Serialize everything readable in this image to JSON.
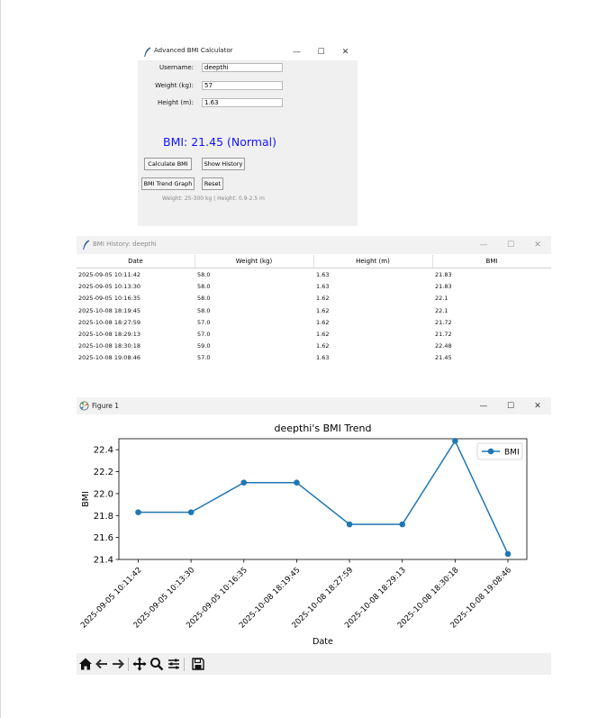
{
  "calculator": {
    "window_title": "Advanced BMI Calculator",
    "username_label": "Username:",
    "username_value": "deepthi",
    "weight_label": "Weight (kg):",
    "weight_value": "57",
    "height_label": "Height (m):",
    "height_value": "1.63",
    "result_text": "BMI: 21.45 (Normal)",
    "result_color": "#1414ff",
    "calculate_button": "Calculate BMI",
    "history_button": "Show History",
    "graph_button": "BMI Trend Graph",
    "reset_button": "Reset",
    "range_hint": "Weight: 25-300 kg | Height: 0.9-2.5 m",
    "minimize_icon": "—",
    "maximize_icon": "☐",
    "close_icon": "✕"
  },
  "history": {
    "window_title": "BMI History: deepthi",
    "columns": [
      "Date",
      "Weight (kg)",
      "Height (m)",
      "BMI"
    ],
    "rows": [
      [
        "2025-09-05 10:11:42",
        "58.0",
        "1.63",
        "21.83"
      ],
      [
        "2025-09-05 10:13:30",
        "58.0",
        "1.63",
        "21.83"
      ],
      [
        "2025-09-05 10:16:35",
        "58.0",
        "1.62",
        "22.1"
      ],
      [
        "2025-10-08 18:19:45",
        "58.0",
        "1.62",
        "22.1"
      ],
      [
        "2025-10-08 18:27:59",
        "57.0",
        "1.62",
        "21.72"
      ],
      [
        "2025-10-08 18:29:13",
        "57.0",
        "1.62",
        "21.72"
      ],
      [
        "2025-10-08 18:30:18",
        "59.0",
        "1.62",
        "22.48"
      ],
      [
        "2025-10-08 19:08:46",
        "57.0",
        "1.63",
        "21.45"
      ]
    ],
    "minimize_icon": "—",
    "maximize_icon": "☐",
    "close_icon": "✕"
  },
  "figure": {
    "window_title": "Figure 1",
    "minimize_icon": "—",
    "maximize_icon": "☐",
    "close_icon": "✕",
    "toolbar": [
      "home-icon",
      "back-arrow-icon",
      "forward-arrow-icon",
      "pan-icon",
      "zoom-icon",
      "configure-subplots-icon",
      "save-icon"
    ]
  },
  "chart_data": {
    "type": "line",
    "title": "deepthi's BMI Trend",
    "xlabel": "Date",
    "ylabel": "BMI",
    "categories": [
      "2025-09-05 10:11:42",
      "2025-09-05 10:13:30",
      "2025-09-05 10:16:35",
      "2025-10-08 18:19:45",
      "2025-10-08 18:27:59",
      "2025-10-08 18:29:13",
      "2025-10-08 18:30:18",
      "2025-10-08 19:08:46"
    ],
    "series": [
      {
        "name": "BMI",
        "values": [
          21.83,
          21.83,
          22.1,
          22.1,
          21.72,
          21.72,
          22.48,
          21.45
        ],
        "color": "#1f77b4",
        "marker": "circle"
      }
    ],
    "ylim": [
      21.4,
      22.5
    ],
    "yticks": [
      21.4,
      21.6,
      21.8,
      22.0,
      22.2,
      22.4
    ],
    "ytick_labels": [
      "21.4",
      "21.6",
      "21.8",
      "22.0",
      "22.2",
      "22.4"
    ],
    "legend_position": "top-right",
    "grid": false
  }
}
